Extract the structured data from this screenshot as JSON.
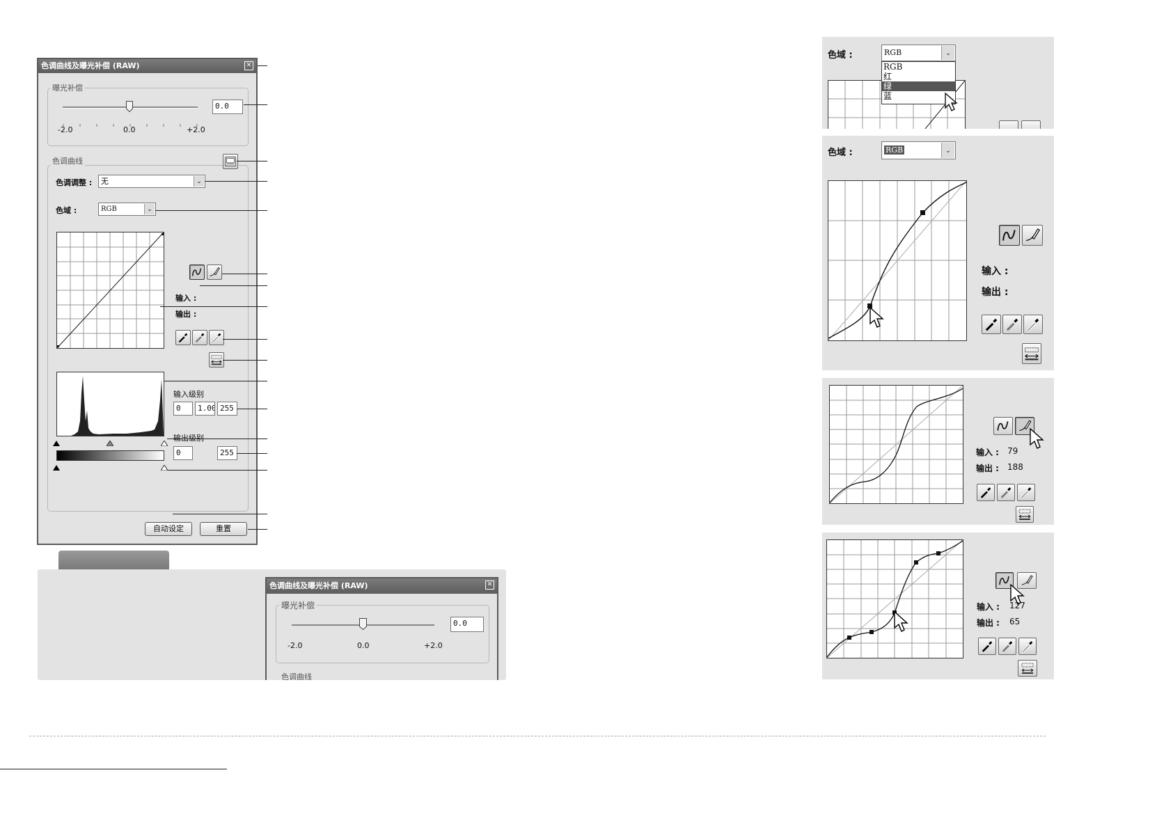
{
  "dialog": {
    "title": "色调曲线及曝光补偿 (RAW)",
    "exposure": {
      "group_title": "曝光补偿",
      "value": "0.0",
      "slider_value": 0.0,
      "ticks": [
        "-2.0",
        "0.0",
        "+2.0"
      ]
    },
    "tone_curve": {
      "group_title": "色调曲线",
      "tone_adjust_label": "色调调整 :",
      "tone_adjust_value": "无",
      "channel_label": "色域 :",
      "channel_value": "RGB",
      "input_label": "输入 :",
      "output_label": "输出 :"
    },
    "levels": {
      "input_levels_label": "输入级别",
      "input_black": "0",
      "input_gamma": "1.00",
      "input_white": "255",
      "output_levels_label": "输出级别",
      "output_black": "0",
      "output_white": "255"
    },
    "buttons": {
      "auto": "自动设定",
      "reset": "重置"
    }
  },
  "preview_dialog": {
    "title": "色调曲线及曝光补偿 (RAW)",
    "group_title": "曝光补偿",
    "value": "0.0",
    "ticks": [
      "-2.0",
      "0.0",
      "+2.0"
    ],
    "partial_group_title": "色调曲线"
  },
  "panel_channel_menu": {
    "label": "色域 :",
    "selected": "RGB",
    "options": [
      "RGB",
      "红",
      "绿",
      "蓝"
    ],
    "highlighted": "绿"
  },
  "panel_curve": {
    "label": "色域 :",
    "selected": "RGB",
    "input_label": "输入 :",
    "output_label": "输出 :"
  },
  "panel_freehand": {
    "input_label": "输入 :",
    "input_value": "79",
    "output_label": "输出 :",
    "output_value": "188"
  },
  "panel_points": {
    "input_label": "输入 :",
    "input_value": "127",
    "output_label": "输出 :",
    "output_value": "65"
  },
  "colors": {
    "panel_bg": "#e3e3e3",
    "title_bar": "#6a6a6a",
    "footer_bar": "#888888"
  },
  "icons": [
    "close-icon",
    "curve-tool-icon",
    "pencil-tool-icon",
    "black-eyedropper-icon",
    "gray-eyedropper-icon",
    "white-eyedropper-icon",
    "apply-levels-icon",
    "save-curve-icon",
    "cursor-arrow-icon",
    "dropdown-arrow-icon"
  ]
}
